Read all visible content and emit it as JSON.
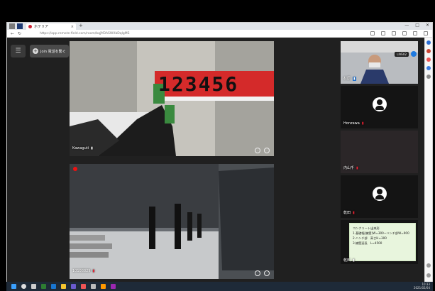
{
  "browser": {
    "tab_title": "ホテリア",
    "new_tab": "+",
    "url": "https://app.remote-field.com/room/bqjM3ASWXbDqlgMS",
    "win_min": "—",
    "win_max": "□",
    "win_close": "✕",
    "nav_back": "←",
    "nav_reload": "↻",
    "tab_close": "×"
  },
  "toolbar": {
    "menu_icon": "☰",
    "join_label": "Join 電話を繋ぐ",
    "plus": "+"
  },
  "videos": [
    {
      "name": "Kawaguti",
      "rulers": "123456"
    },
    {
      "name": "10108829"
    }
  ],
  "side": {
    "tile1_name": "杉原",
    "tile1_pill": "LIVE02",
    "tile2_name": "Honzawa",
    "tile3_name": "内山千",
    "tile4_name": "乾田",
    "tile5_name": "乾田",
    "note_lines": [
      "コンクリート出来形",
      "1.基礎幅(擁壁)W=300~ハンチ部W=900",
      "2.ハンチ部　高さH=300",
      "3.擁壁延長　L=4500"
    ]
  },
  "taskbar": {
    "time": "10:33",
    "date": "2021/02/04"
  },
  "colors": {
    "app_bg": "#202020",
    "accent": "#1f7ae0",
    "mic_off": "#e23"
  }
}
